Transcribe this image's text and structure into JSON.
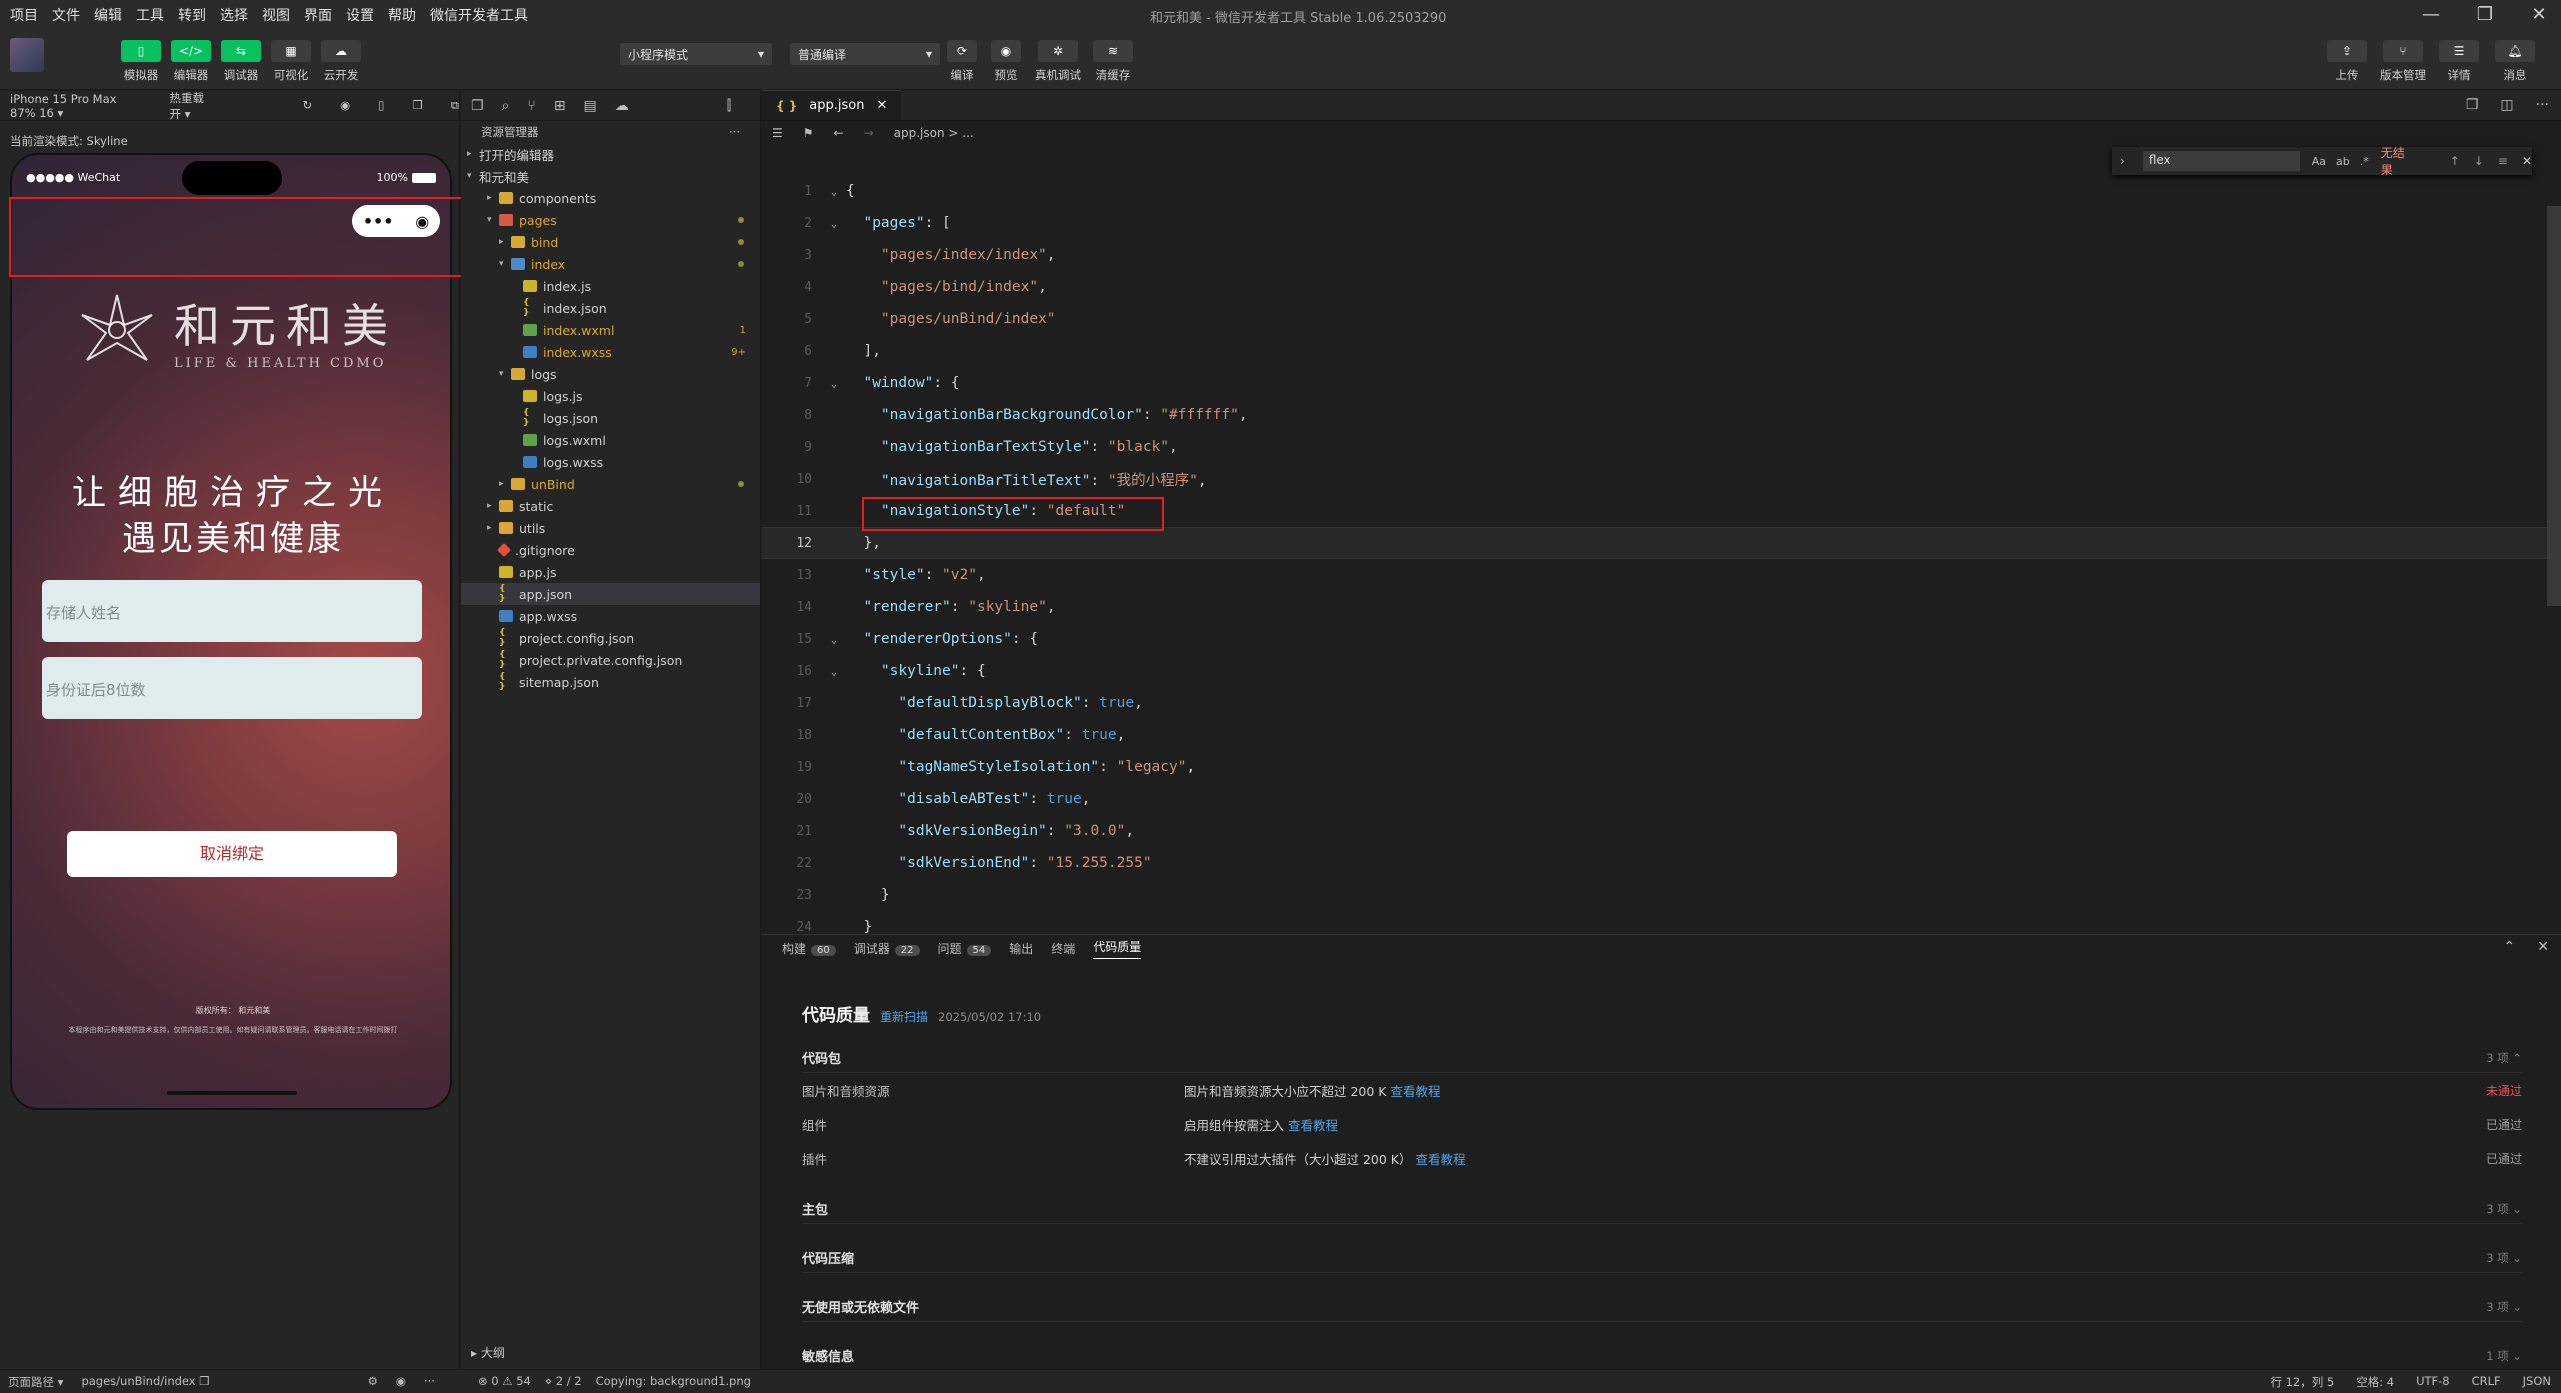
{
  "menubar": {
    "items": [
      "项目",
      "文件",
      "编辑",
      "工具",
      "转到",
      "选择",
      "视图",
      "界面",
      "设置",
      "帮助",
      "微信开发者工具"
    ],
    "window_title": "和元和美 - 微信开发者工具 Stable 1.06.2503290"
  },
  "toolbar": {
    "left_buttons": [
      "模拟器",
      "编辑器",
      "调试器",
      "可视化",
      "云开发"
    ],
    "mode_select": "小程序模式",
    "compile_select": "普通编译",
    "mid_buttons": [
      "编译",
      "预览",
      "真机调试",
      "清缓存"
    ],
    "right_buttons": [
      "上传",
      "版本管理",
      "详情",
      "消息"
    ]
  },
  "simulator": {
    "device": "iPhone 15 Pro Max 87% 16 ▾",
    "hot_reload": "热重载 开 ▾",
    "render_mode": "当前渲染模式: Skyline",
    "status_left": "●●●●● WeChat",
    "status_right": "100%",
    "capsule_menu": "•••",
    "capsule_close": "◉",
    "logo_cn": "和元和美",
    "logo_en": "LIFE & HEALTH CDMO",
    "slogan_line1": "让细胞治疗之光",
    "slogan_line2": "遇见美和健康",
    "name_placeholder": "存储人姓名",
    "id_placeholder": "身份证后8位数",
    "unbind_button": "取消绑定",
    "footer_line1": "版权所有：",
    "footer_logo": "和元和美",
    "footer_line2": "本程序由和元和美提供技术支持，仅供内部员工使用。如有疑问请联系管理员。客服电话请在工作时间拨打"
  },
  "explorer": {
    "title": "资源管理器",
    "open_editors": "打开的编辑器",
    "project": "和元和美",
    "outline": "大纲",
    "tree": [
      {
        "name": "components",
        "type": "folder",
        "depth": 1,
        "arrow": "▸"
      },
      {
        "name": "pages",
        "type": "folder-red",
        "depth": 1,
        "arrow": "▾",
        "dot": true,
        "color": "#d8a837"
      },
      {
        "name": "bind",
        "type": "folder",
        "depth": 2,
        "arrow": "▸",
        "dot": true,
        "color": "#d8a837"
      },
      {
        "name": "index",
        "type": "folder-blue",
        "depth": 2,
        "arrow": "▾",
        "dot": true,
        "color": "#d8a837"
      },
      {
        "name": "index.js",
        "type": "js",
        "depth": 3
      },
      {
        "name": "index.json",
        "type": "json",
        "depth": 3
      },
      {
        "name": "index.wxml",
        "type": "wxml",
        "depth": 3,
        "badge": "1",
        "color": "#d8a837"
      },
      {
        "name": "index.wxss",
        "type": "wxss",
        "depth": 3,
        "badge": "9+",
        "color": "#d8a837"
      },
      {
        "name": "logs",
        "type": "folder",
        "depth": 2,
        "arrow": "▾"
      },
      {
        "name": "logs.js",
        "type": "js",
        "depth": 3
      },
      {
        "name": "logs.json",
        "type": "json",
        "depth": 3
      },
      {
        "name": "logs.wxml",
        "type": "wxml",
        "depth": 3
      },
      {
        "name": "logs.wxss",
        "type": "wxss",
        "depth": 3
      },
      {
        "name": "unBind",
        "type": "folder",
        "depth": 2,
        "arrow": "▸",
        "dot": true,
        "color": "#d8a837"
      },
      {
        "name": "static",
        "type": "folder",
        "depth": 1,
        "arrow": "▸"
      },
      {
        "name": "utils",
        "type": "folder",
        "depth": 1,
        "arrow": "▸"
      },
      {
        "name": ".gitignore",
        "type": "git",
        "depth": 1
      },
      {
        "name": "app.js",
        "type": "js",
        "depth": 1
      },
      {
        "name": "app.json",
        "type": "json",
        "depth": 1,
        "selected": true
      },
      {
        "name": "app.wxss",
        "type": "wxss",
        "depth": 1
      },
      {
        "name": "project.config.json",
        "type": "json",
        "depth": 1
      },
      {
        "name": "project.private.config.json",
        "type": "json",
        "depth": 1
      },
      {
        "name": "sitemap.json",
        "type": "json",
        "depth": 1
      }
    ]
  },
  "editor": {
    "tab_label": "app.json",
    "breadcrumb": "app.json > ...",
    "find_text": "flex",
    "find_opts": [
      "Aa",
      "ab",
      ".*"
    ],
    "find_result": "无结果",
    "current_line": 12,
    "lines": [
      {
        "n": 1,
        "fold": "⌄",
        "parts": [
          [
            "p",
            "{"
          ]
        ]
      },
      {
        "n": 2,
        "fold": "⌄",
        "parts": [
          [
            "k",
            "  \"pages\""
          ],
          [
            "p",
            ": ["
          ]
        ]
      },
      {
        "n": 3,
        "parts": [
          [
            "s",
            "    \"pages/index/index\""
          ],
          [
            "p",
            ","
          ]
        ]
      },
      {
        "n": 4,
        "parts": [
          [
            "s",
            "    \"pages/bind/index\""
          ],
          [
            "p",
            ","
          ]
        ]
      },
      {
        "n": 5,
        "parts": [
          [
            "s",
            "    \"pages/unBind/index\""
          ]
        ]
      },
      {
        "n": 6,
        "parts": [
          [
            "p",
            "  ],"
          ]
        ]
      },
      {
        "n": 7,
        "fold": "⌄",
        "parts": [
          [
            "k",
            "  \"window\""
          ],
          [
            "p",
            ": {"
          ]
        ]
      },
      {
        "n": 8,
        "parts": [
          [
            "k",
            "    \"navigationBarBackgroundColor\""
          ],
          [
            "p",
            ": "
          ],
          [
            "s",
            "\"#ffffff\""
          ],
          [
            "p",
            ","
          ]
        ]
      },
      {
        "n": 9,
        "parts": [
          [
            "k",
            "    \"navigationBarTextStyle\""
          ],
          [
            "p",
            ": "
          ],
          [
            "s",
            "\"black\""
          ],
          [
            "p",
            ","
          ]
        ]
      },
      {
        "n": 10,
        "parts": [
          [
            "k",
            "    \"navigationBarTitleText\""
          ],
          [
            "p",
            ": "
          ],
          [
            "s",
            "\"我的小程序\""
          ],
          [
            "p",
            ","
          ]
        ]
      },
      {
        "n": 11,
        "parts": [
          [
            "k",
            "    \"navigationStyle\""
          ],
          [
            "p",
            ": "
          ],
          [
            "s",
            "\"default\""
          ]
        ]
      },
      {
        "n": 12,
        "parts": [
          [
            "p",
            "  },"
          ]
        ]
      },
      {
        "n": 13,
        "parts": [
          [
            "k",
            "  \"style\""
          ],
          [
            "p",
            ": "
          ],
          [
            "s",
            "\"v2\""
          ],
          [
            "p",
            ","
          ]
        ]
      },
      {
        "n": 14,
        "parts": [
          [
            "k",
            "  \"renderer\""
          ],
          [
            "p",
            ": "
          ],
          [
            "s",
            "\"skyline\""
          ],
          [
            "p",
            ","
          ]
        ]
      },
      {
        "n": 15,
        "fold": "⌄",
        "parts": [
          [
            "k",
            "  \"rendererOptions\""
          ],
          [
            "p",
            ": {"
          ]
        ]
      },
      {
        "n": 16,
        "fold": "⌄",
        "parts": [
          [
            "k",
            "    \"skyline\""
          ],
          [
            "p",
            ": {"
          ]
        ]
      },
      {
        "n": 17,
        "parts": [
          [
            "k",
            "      \"defaultDisplayBlock\""
          ],
          [
            "p",
            ": "
          ],
          [
            "b",
            "true"
          ],
          [
            "p",
            ","
          ]
        ]
      },
      {
        "n": 18,
        "parts": [
          [
            "k",
            "      \"defaultContentBox\""
          ],
          [
            "p",
            ": "
          ],
          [
            "b",
            "true"
          ],
          [
            "p",
            ","
          ]
        ]
      },
      {
        "n": 19,
        "parts": [
          [
            "k",
            "      \"tagNameStyleIsolation\""
          ],
          [
            "p",
            ": "
          ],
          [
            "s",
            "\"legacy\""
          ],
          [
            "p",
            ","
          ]
        ]
      },
      {
        "n": 20,
        "parts": [
          [
            "k",
            "      \"disableABTest\""
          ],
          [
            "p",
            ": "
          ],
          [
            "b",
            "true"
          ],
          [
            "p",
            ","
          ]
        ]
      },
      {
        "n": 21,
        "parts": [
          [
            "k",
            "      \"sdkVersionBegin\""
          ],
          [
            "p",
            ": "
          ],
          [
            "s",
            "\"3.0.0\""
          ],
          [
            "p",
            ","
          ]
        ]
      },
      {
        "n": 22,
        "parts": [
          [
            "k",
            "      \"sdkVersionEnd\""
          ],
          [
            "p",
            ": "
          ],
          [
            "s",
            "\"15.255.255\""
          ]
        ]
      },
      {
        "n": 23,
        "parts": [
          [
            "p",
            "    }"
          ]
        ]
      },
      {
        "n": 24,
        "parts": [
          [
            "p",
            "  }"
          ]
        ]
      }
    ]
  },
  "panel": {
    "tabs": [
      {
        "label": "构建",
        "count": "60"
      },
      {
        "label": "调试器",
        "count": "22"
      },
      {
        "label": "问题",
        "count": "54"
      },
      {
        "label": "输出",
        "count": ""
      },
      {
        "label": "终端",
        "count": ""
      },
      {
        "label": "代码质量",
        "count": "",
        "active": true
      }
    ],
    "title": "代码质量",
    "rescan": "重新扫描",
    "date": "2025/05/02 17:10",
    "sections": [
      {
        "label": "代码包",
        "count": "3 项 ⌃",
        "rows": [
          {
            "name": "图片和音频资源",
            "desc": "图片和音频资源大小应不超过 200 K",
            "link": "查看教程",
            "status": "未通过",
            "fail": true
          },
          {
            "name": "组件",
            "desc": "启用组件按需注入",
            "link": "查看教程",
            "status": "已通过",
            "fail": false
          },
          {
            "name": "插件",
            "desc": "不建议引用过大插件（大小超过 200 K）",
            "link": "查看教程",
            "status": "已通过",
            "fail": false
          }
        ]
      },
      {
        "label": "主包",
        "count": "3 项 ⌄",
        "rows": []
      },
      {
        "label": "代码压缩",
        "count": "3 项 ⌄",
        "rows": []
      },
      {
        "label": "无使用或无依赖文件",
        "count": "3 项 ⌄",
        "rows": []
      },
      {
        "label": "敏感信息",
        "count": "1 项 ⌄",
        "rows": []
      }
    ]
  },
  "statusbar": {
    "page_path_label": "页面路径 ▾",
    "page_path": "pages/unBind/index",
    "errors": "⊗ 0 ⚠ 54",
    "pages": "⋄ 2 / 2",
    "copying": "Copying: background1.png",
    "position": "行 12，列 5",
    "spaces": "空格: 4",
    "encoding": "UTF-8",
    "eol": "CRLF",
    "lang": "JSON"
  }
}
